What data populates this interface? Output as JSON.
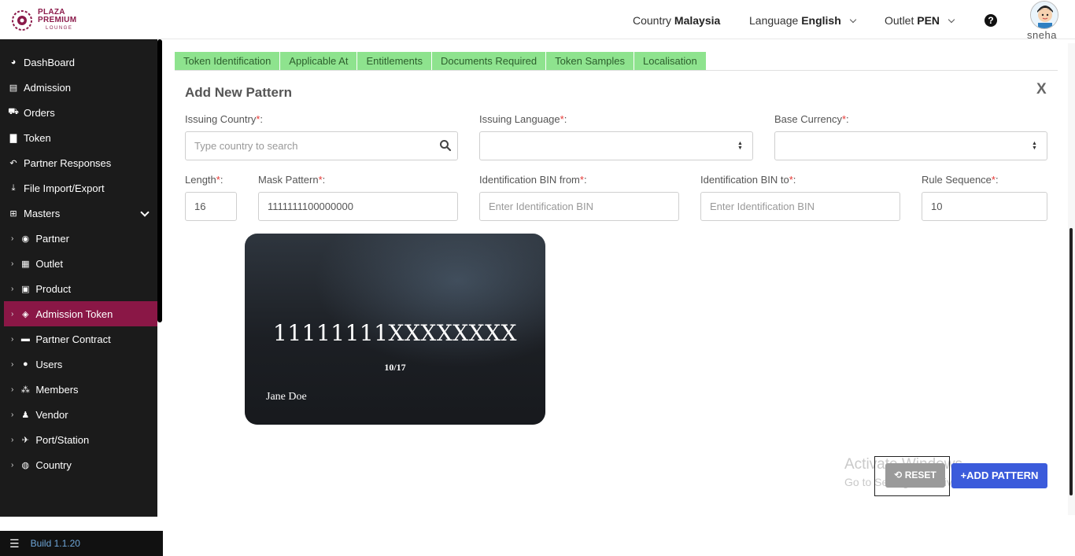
{
  "header": {
    "brand_line1": "PLAZA",
    "brand_line2": "PREMIUM",
    "brand_line3": "LOUNGE",
    "country_label": "Country",
    "country_value": "Malaysia",
    "language_label": "Language",
    "language_value": "English",
    "outlet_label": "Outlet",
    "outlet_value": "PEN",
    "help_icon": "?",
    "user_name": "sneha"
  },
  "sidebar": {
    "items": [
      {
        "label": "DashBoard",
        "icon": "dashboard-icon"
      },
      {
        "label": "Admission",
        "icon": "id-card-icon"
      },
      {
        "label": "Orders",
        "icon": "cart-icon"
      },
      {
        "label": "Token",
        "icon": "file-icon"
      },
      {
        "label": "Partner Responses",
        "icon": "reply-icon"
      },
      {
        "label": "File Import/Export",
        "icon": "download-icon"
      },
      {
        "label": "Masters",
        "icon": "sitemap-icon"
      }
    ],
    "sub_items": [
      {
        "label": "Partner",
        "icon": "eye-icon"
      },
      {
        "label": "Outlet",
        "icon": "building-icon"
      },
      {
        "label": "Product",
        "icon": "gift-icon"
      },
      {
        "label": "Admission Token",
        "icon": "tag-icon"
      },
      {
        "label": "Partner Contract",
        "icon": "briefcase-icon"
      },
      {
        "label": "Users",
        "icon": "user-icon"
      },
      {
        "label": "Members",
        "icon": "users-icon"
      },
      {
        "label": "Vendor",
        "icon": "person-icon"
      },
      {
        "label": "Port/Station",
        "icon": "plane-icon"
      },
      {
        "label": "Country",
        "icon": "globe-icon"
      }
    ],
    "build_label": "Build 1.1.20"
  },
  "tabs": [
    "Token Identification",
    "Applicable At",
    "Entitlements",
    "Documents Required",
    "Token Samples",
    "Localisation"
  ],
  "form": {
    "title": "Add New Pattern",
    "close": "X",
    "issuing_country_label": "Issuing Country",
    "issuing_country_placeholder": "Type country to search",
    "issuing_language_label": "Issuing Language",
    "base_currency_label": "Base Currency",
    "length_label": "Length",
    "length_value": "16",
    "mask_pattern_label": "Mask Pattern",
    "mask_pattern_value": "1111111100000000",
    "bin_from_label": "Identification BIN from",
    "bin_from_placeholder": "Enter Identification BIN",
    "bin_to_label": "Identification BIN to",
    "bin_to_placeholder": "Enter Identification BIN",
    "rule_sequence_label": "Rule Sequence",
    "rule_sequence_value": "10",
    "required_mark": "*",
    "colon": ":"
  },
  "card": {
    "number": "11111111XXXXXXXX",
    "expiry": "10/17",
    "holder": "Jane Doe"
  },
  "actions": {
    "reset_label": "RESET",
    "add_label": "ADD PATTERN"
  },
  "watermark": {
    "line1": "Activate Windows",
    "line2": "Go to Settings to activate Windows."
  },
  "colors": {
    "accent": "#8a1746",
    "tab_bg": "#8ee38e",
    "primary_button": "#3b5bdb"
  }
}
